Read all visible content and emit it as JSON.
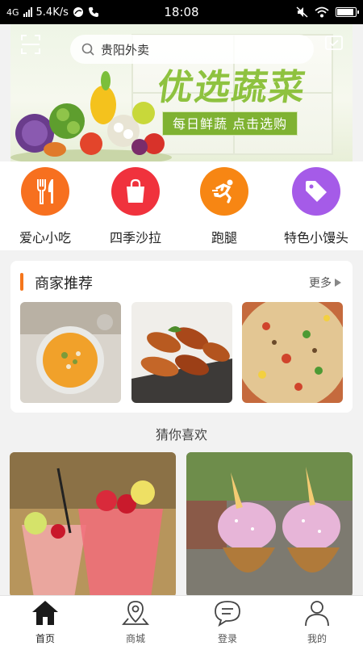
{
  "status_bar": {
    "network": "4G",
    "speed": "5.4K/s",
    "time": "18:08"
  },
  "banner": {
    "title": "优选蔬菜",
    "subtitle": "每日鲜蔬 点击选购"
  },
  "search": {
    "value": "贵阳外卖"
  },
  "categories": [
    {
      "label": "爱心小吃",
      "icon": "fork-knife-icon",
      "color": "#f7701f"
    },
    {
      "label": "四季沙拉",
      "icon": "shopping-bag-icon",
      "color": "#f0323d"
    },
    {
      "label": "跑腿",
      "icon": "running-man-icon",
      "color": "#f78613"
    },
    {
      "label": "特色小馒头",
      "icon": "tag-icon",
      "color": "#a55be8"
    }
  ],
  "merchant_section": {
    "title": "商家推荐",
    "more": "更多",
    "images": [
      "pumpkin-soup",
      "grilled-chicken-wings",
      "fried-rice"
    ]
  },
  "guess_section": {
    "title": "猜你喜欢",
    "images": [
      "strawberry-drinks",
      "unicorn-ice-cream"
    ]
  },
  "tab_bar": {
    "items": [
      {
        "label": "首页",
        "icon": "home-icon",
        "active": true
      },
      {
        "label": "商城",
        "icon": "map-pin-icon",
        "active": false
      },
      {
        "label": "登录",
        "icon": "chat-bubble-icon",
        "active": false
      },
      {
        "label": "我的",
        "icon": "user-icon",
        "active": false
      }
    ]
  },
  "colors": {
    "accent": "#f5761c",
    "banner_green": "#8ec23f"
  }
}
